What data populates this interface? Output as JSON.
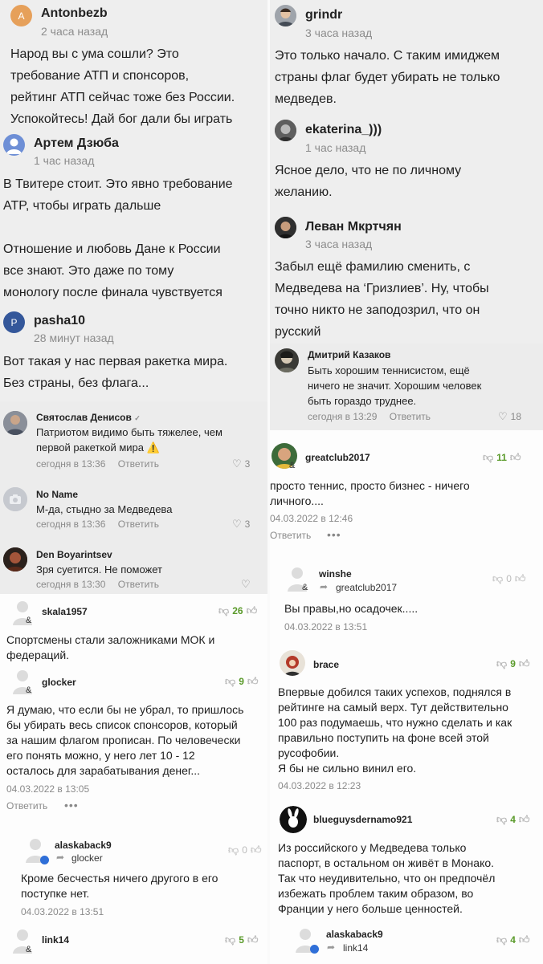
{
  "colors": {
    "green": "#5a9a2a",
    "orange_avatar": "#e6a05a",
    "blue_avatar": "#6e8fd6",
    "navy_avatar": "#34579a",
    "muted": "#8a8a8a"
  },
  "left": {
    "big_comments": [
      {
        "initial": "A",
        "name": "Antonbezb",
        "time": "2 часа назад",
        "text": "Народ вы с ума сошли? Это\nтребование АТП и спонсоров,\nрейтинг АТП сейчас тоже без России.\nУспокойтесь! Дай бог дали бы играть"
      },
      {
        "initial": "",
        "name": "Артем Дзюба",
        "time": "1 час назад",
        "text": "В Твитере стоит. Это явно требование\nATP, чтобы играть дальше\n\nОтношение и любовь Дане к России\nвсе знают. Это даже по тому\nмонологу после финала чувствуется"
      },
      {
        "initial": "P",
        "name": "pasha10",
        "time": "28 минут назад",
        "text": "Вот такая у нас первая ракетка мира.\nБез страны, без флага..."
      }
    ],
    "thread_comments": [
      {
        "name": "Святослав Денисов",
        "badge": "✓",
        "text": "Патриотом видимо быть тяжелее, чем\nпервой ракеткой мира ⚠️",
        "date": "сегодня в 13:36",
        "reply": "Ответить",
        "likes": "3"
      },
      {
        "name": "No Name",
        "text": "М-да, стыдно за Медведева",
        "date": "сегодня в 13:36",
        "reply": "Ответить",
        "likes": "3"
      },
      {
        "name": "Den Boyarintsev",
        "text": "Зря суетится. Не поможет",
        "date": "сегодня в 13:30",
        "reply": "Ответить",
        "likes": ""
      }
    ],
    "forum_comments": [
      {
        "name": "skala1957",
        "rating": "26",
        "rating_color": "green",
        "text": "Спортсмены стали заложниками МОК и\nфедераций."
      },
      {
        "name": "glocker",
        "rating": "9",
        "rating_color": "green",
        "text": "Я думаю, что если бы не убрал, то пришлось\nбы убирать весь список спонсоров, который\nза нашим флагом прописан. По человечески\nего понять можно, у него лет 10 - 12\nосталось для зарабатывания денег...",
        "date": "04.03.2022 в 13:05",
        "reply": "Ответить",
        "dots": "•••"
      },
      {
        "name": "alaskaback9",
        "reply_to": "glocker",
        "rating": "0",
        "rating_color": "gray",
        "text": "Кроме бесчестья ничего другого в его\nпоступке нет.",
        "date": "04.03.2022 в 13:51"
      },
      {
        "name": "link14",
        "rating": "5",
        "rating_color": "green"
      }
    ]
  },
  "right": {
    "big_comments": [
      {
        "name": "grindr",
        "time": "3 часа назад",
        "text": "Это только начало. С таким имиджем\nстраны флаг будет убирать не только\nмедведев."
      },
      {
        "name": "ekaterina_)))",
        "time": "1 час назад",
        "text": "Ясное дело, что не по личному\nжеланию."
      },
      {
        "name": "Леван Мкртчян",
        "time": "3 часа назад",
        "text": "Забыл ещё фамилию сменить, с\nМедведева на ‘Гризлиев’. Ну, чтобы\nточно никто не заподозрил, что он\nрусский"
      }
    ],
    "thread_comments": [
      {
        "name": "Дмитрий Казаков",
        "text": "Быть хорошим теннисистом, ещё\nничего не значит. Хорошим человек\nбыть гораздо труднее.",
        "date": "сегодня в 13:29",
        "reply": "Ответить",
        "likes": "18"
      }
    ],
    "forum_comments": [
      {
        "name": "greatclub2017",
        "rating": "11",
        "rating_color": "green",
        "text": "просто теннис, просто бизнес - ничего\nличного....",
        "date": "04.03.2022 в 12:46",
        "reply": "Ответить",
        "dots": "•••"
      },
      {
        "name": "winshe",
        "reply_to": "greatclub2017",
        "rating": "0",
        "rating_color": "gray",
        "text": "Вы правы,но осадочек.....",
        "date": "04.03.2022 в 13:51"
      },
      {
        "name": "brace",
        "rating": "9",
        "rating_color": "green",
        "text": "Впервые добился таких успехов, поднялся в\nрейтинге на самый верх. Тут действительно\n100 раз подумаешь, что нужно сделать и как\nправильно поступить на фоне всей этой\nрусофобии.\nЯ бы не сильно винил его.",
        "date": "04.03.2022 в 12:23"
      },
      {
        "name": "blueguysdernamo921",
        "rating": "4",
        "rating_color": "green",
        "text": "Из российского у Медведева только\nпаспорт, в остальном он живёт в Монако.\nТак что неудивительно, что он предпочёл\nизбежать проблем таким образом, во\nФранции у него больше ценностей."
      },
      {
        "name": "alaskaback9",
        "reply_to": "link14",
        "rating": "4",
        "rating_color": "green"
      }
    ]
  }
}
